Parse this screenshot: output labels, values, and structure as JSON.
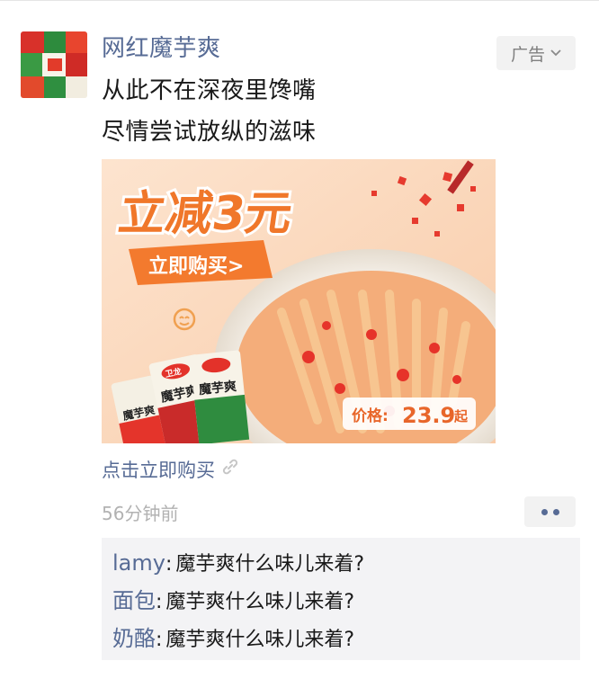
{
  "post": {
    "author": "网红魔芋爽",
    "lines": [
      "从此不在深夜里馋嘴",
      "尽情尝试放纵的滋味"
    ],
    "ad_label": "广告",
    "ad_image": {
      "headline": "立减3元",
      "cta": "立即购买>",
      "price_label": "价格:",
      "price_value": "23.9",
      "price_suffix": "起",
      "brand": "卫龙",
      "product": "魔芋爽"
    },
    "link_text": "点击立即购买",
    "time": "56分钟前"
  },
  "comments": [
    {
      "user": "lamy",
      "text": "魔芋爽什么味儿来着?"
    },
    {
      "user": "面包",
      "text": "魔芋爽什么味儿来着?"
    },
    {
      "user": "奶酪",
      "text": "魔芋爽什么味儿来着?"
    }
  ],
  "colors": {
    "link_blue": "#576b95",
    "ad_orange": "#f0772a",
    "comment_bg": "#f3f3f5"
  }
}
